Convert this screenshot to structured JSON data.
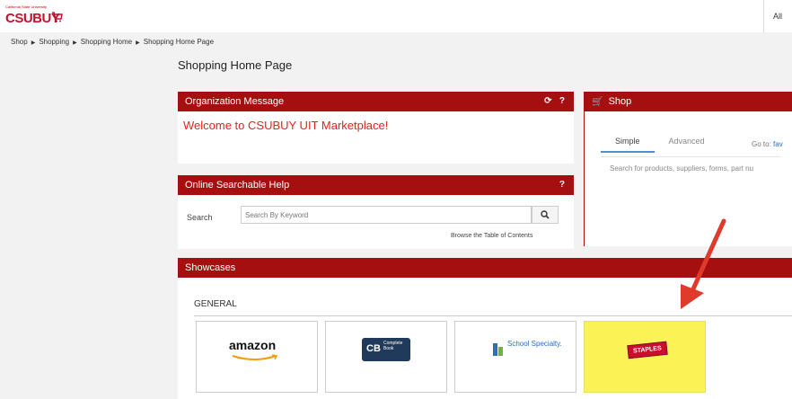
{
  "header": {
    "logo_small_text": "California State University",
    "logo_text": "CSUBUY",
    "all_label": "All"
  },
  "breadcrumb": [
    "Shop",
    "Shopping",
    "Shopping Home",
    "Shopping Home Page"
  ],
  "page_title": "Shopping Home Page",
  "org_message": {
    "title": "Organization Message",
    "refresh_icon": "refresh-icon",
    "help_label": "?",
    "text": "Welcome to  CSUBUY UIT Marketplace!"
  },
  "help_panel": {
    "title": "Online Searchable Help",
    "help_label": "?",
    "search_label": "Search",
    "search_placeholder": "Search By Keyword",
    "search_icon": "search-icon",
    "toc_link": "Browse the Table of Contents"
  },
  "shop_panel": {
    "title": "Shop",
    "cart_icon": "cart-icon",
    "tabs": [
      "Simple",
      "Advanced"
    ],
    "active_tab": "Simple",
    "goto_label": "Go to:",
    "goto_link": "fav",
    "search_placeholder": "Search for products, suppliers, forms, part nu"
  },
  "showcases": {
    "title": "Showcases",
    "section_label": "GENERAL",
    "tiles": [
      {
        "name": "amazon",
        "logo_text": "amazon"
      },
      {
        "name": "complete-book",
        "logo_text": "Complete Book"
      },
      {
        "name": "school-specialty",
        "logo_text": "School Specialty."
      },
      {
        "name": "staples",
        "logo_text": "STAPLES"
      }
    ]
  },
  "colors": {
    "panel_header": "#a50f0f",
    "message_text": "#e8211d",
    "staples_tile": "#fbf256",
    "arrow": "#e03a2c"
  }
}
